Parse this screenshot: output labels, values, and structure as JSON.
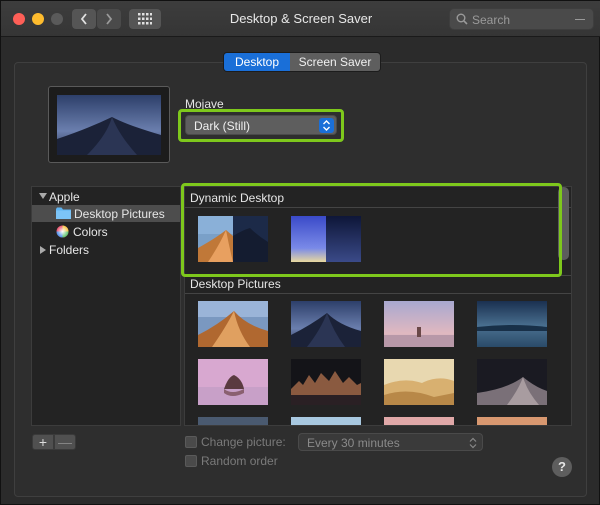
{
  "window": {
    "title": "Desktop & Screen Saver"
  },
  "search": {
    "placeholder": "Search"
  },
  "tabs": [
    {
      "label": "Desktop",
      "active": true
    },
    {
      "label": "Screen Saver",
      "active": false
    }
  ],
  "current": {
    "name": "Mojave",
    "mode": "Dark (Still)"
  },
  "sidebar": {
    "items": [
      {
        "label": "Apple",
        "type": "group",
        "expanded": true
      },
      {
        "label": "Desktop Pictures",
        "type": "folder",
        "selected": true
      },
      {
        "label": "Colors",
        "type": "colors"
      },
      {
        "label": "Folders",
        "type": "group",
        "expanded": false
      }
    ]
  },
  "groups": {
    "dynamic": {
      "label": "Dynamic Desktop"
    },
    "pictures": {
      "label": "Desktop Pictures"
    }
  },
  "bottom": {
    "add_label": "+",
    "remove_label": "—",
    "change_picture_label": "Change picture:",
    "interval": "Every 30 minutes",
    "random_label": "Random order",
    "help_label": "?"
  },
  "colors": {
    "accent": "#1a6fd8",
    "highlight": "#7ec81c",
    "traffic_red": "#fe5f57",
    "traffic_yellow": "#febc2e"
  }
}
